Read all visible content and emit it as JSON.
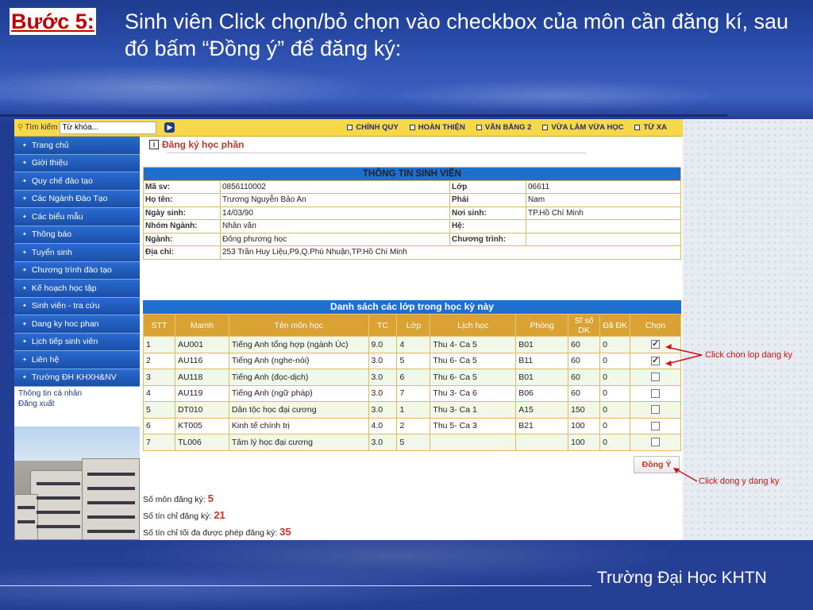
{
  "slide": {
    "step_label": "Bước 5:",
    "step_text": "Sinh viên Click chọn/bỏ chọn vào checkbox của môn cần đăng kí, sau đó bấm “Đồng ý” để đăng ký:",
    "footer": "Trường Đại Học KHTN"
  },
  "topbar": {
    "search_label": "Tìm kiếm",
    "search_placeholder": "Từ khóa...",
    "links": [
      "CHÍNH QUY",
      "HOÀN THIỆN",
      "VĂN BẰNG 2",
      "VỪA LÀM VỪA HỌC",
      "TỪ XA"
    ]
  },
  "sidebar": {
    "items": [
      "Trang chủ",
      "Giới thiệu",
      "Quy chế đào tạo",
      "Các Ngành Đào Tạo",
      "Các biểu mẫu",
      "Thông báo",
      "Tuyển sinh",
      "Chương trình đào tạo",
      "Kế hoạch học tập",
      "Sinh viên - tra cứu",
      "Dang ky hoc phan",
      "Lịch tiếp sinh viên",
      "Liên hệ",
      "Trường ĐH KHXH&NV"
    ],
    "links": [
      "Thông tin cá nhân",
      "Đăng xuất"
    ]
  },
  "main": {
    "page_title": "Đăng ký học phần",
    "info_title": "THÔNG TIN SINH VIÊN",
    "info": {
      "ma_sv_k": "Mã sv:",
      "ma_sv_v": "0856110002",
      "lop_k": "Lớp",
      "lop_v": "06611",
      "ho_ten_k": "Họ tên:",
      "ho_ten_v": "Trương Nguyễn Bảo An",
      "phai_k": "Phái",
      "phai_v": "Nam",
      "ngay_sinh_k": "Ngày sinh:",
      "ngay_sinh_v": "14/03/90",
      "noi_sinh_k": "Nơi sinh:",
      "noi_sinh_v": "TP.Hồ Chí Minh",
      "nhom_nganh_k": "Nhóm Ngành:",
      "nhom_nganh_v": "Nhân văn",
      "he_k": "Hệ:",
      "he_v": "",
      "nganh_k": "Ngành:",
      "nganh_v": "Đông phương học",
      "chuong_trinh_k": "Chương trình:",
      "chuong_trinh_v": "",
      "dia_chi_k": "Địa chỉ:",
      "dia_chi_v": "253 Trần Huy Liệu,P9,Q.Phú Nhuận,TP.Hồ Chí Minh"
    },
    "classes_title": "Danh sách các lớp trong học kỳ này",
    "columns": [
      "STT",
      "Mamh",
      "Tên môn học",
      "TC",
      "Lớp",
      "Lịch học",
      "Phòng",
      "Sĩ số DK",
      "Đã ĐK",
      "Chọn"
    ],
    "rows": [
      {
        "stt": "1",
        "mamh": "AU001",
        "ten": "Tiếng Anh tổng hợp (ngành Úc)",
        "tc": "9.0",
        "lop": "4",
        "lich": "Thu 4- Ca 5",
        "phong": "B01",
        "siso": "60",
        "dadk": "0",
        "checked": true
      },
      {
        "stt": "2",
        "mamh": "AU116",
        "ten": "Tiếng Anh (nghe-nói)",
        "tc": "3.0",
        "lop": "5",
        "lich": "Thu 6- Ca 5",
        "phong": "B11",
        "siso": "60",
        "dadk": "0",
        "checked": true
      },
      {
        "stt": "3",
        "mamh": "AU118",
        "ten": "Tiếng Anh (đọc-dịch)",
        "tc": "3.0",
        "lop": "6",
        "lich": "Thu 6- Ca 5",
        "phong": "B01",
        "siso": "60",
        "dadk": "0",
        "checked": false
      },
      {
        "stt": "4",
        "mamh": "AU119",
        "ten": "Tiếng Anh (ngữ pháp)",
        "tc": "3.0",
        "lop": "7",
        "lich": "Thu 3- Ca 6",
        "phong": "B06",
        "siso": "60",
        "dadk": "0",
        "checked": false
      },
      {
        "stt": "5",
        "mamh": "DT010",
        "ten": "Dân tộc học đại cương",
        "tc": "3.0",
        "lop": "1",
        "lich": "Thu 3- Ca 1",
        "phong": "A15",
        "siso": "150",
        "dadk": "0",
        "checked": false
      },
      {
        "stt": "6",
        "mamh": "KT005",
        "ten": "Kinh tế chính trị",
        "tc": "4.0",
        "lop": "2",
        "lich": "Thu 5- Ca 3",
        "phong": "B21",
        "siso": "100",
        "dadk": "0",
        "checked": false
      },
      {
        "stt": "7",
        "mamh": "TL006",
        "ten": "Tâm lý học đại cương",
        "tc": "3.0",
        "lop": "5",
        "lich": "",
        "phong": "",
        "siso": "100",
        "dadk": "0",
        "checked": false
      }
    ],
    "agree_label": "Đồng Ý",
    "summary": {
      "so_mon_label": "Số môn đăng ký:",
      "so_mon": "5",
      "so_tc_label": "Số tín chỉ đăng ký:",
      "so_tc": "21",
      "max_tc_label": "Số tín chỉ tối đa được phép đăng ký:",
      "max_tc": "35"
    }
  },
  "annotations": {
    "click_row": "Click chon lop dang ky",
    "click_agree": "Click dong y dang ky",
    "color": "#d01010"
  }
}
